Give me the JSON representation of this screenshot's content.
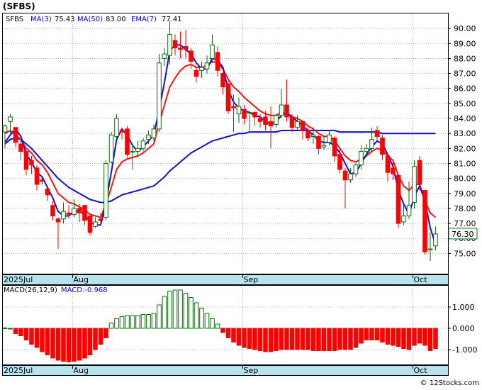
{
  "title": "(SFBS)",
  "legend": {
    "ticker": "SFBS",
    "ma3_label": "MA(3)",
    "ma3_value": "75.43",
    "ma50_label": "MA(50)",
    "ma50_value": "83.00",
    "ema7_label": "EMA(7)",
    "ema7_value": "77.41"
  },
  "macd_legend": {
    "label": "MACD(26,12,9)",
    "value_text": "MACD:-0.968"
  },
  "last_price": "76.30",
  "watermark": "© 12Stocks.com",
  "colors": {
    "up": "#0a6b0a",
    "down": "#ff0000",
    "ma_blue": "#1010d0",
    "ema_red": "#ff1010",
    "axis_strip": "#b7e3ef",
    "legend_blue": "#0000ff"
  },
  "chart_data": {
    "type": "candlestick",
    "price_axis": {
      "ylim": [
        73.6,
        91.0
      ],
      "ticks": [
        75.0,
        76.0,
        77.0,
        78.0,
        79.0,
        80.0,
        81.0,
        82.0,
        83.0,
        84.0,
        85.0,
        86.0,
        87.0,
        88.0,
        89.0,
        90.0
      ]
    },
    "price_tick_labels": [
      "75.00",
      "76.00",
      "77.00",
      "78.00",
      "79.00",
      "80.00",
      "81.00",
      "82.00",
      "83.00",
      "84.00",
      "85.00",
      "86.00",
      "87.00",
      "88.00",
      "89.00",
      "90.00"
    ],
    "x_labels": [
      {
        "text": "2025Jul",
        "index": 0
      },
      {
        "text": "Aug",
        "index": 13
      },
      {
        "text": "Sep",
        "index": 45
      },
      {
        "text": "Oct",
        "index": 77
      }
    ],
    "candles": [
      [
        83.1,
        83.6,
        83.5,
        82.0
      ],
      [
        83.8,
        84.3,
        84.1,
        83.0
      ],
      [
        83.4,
        83.4,
        82.4,
        82.1
      ],
      [
        82.3,
        82.6,
        81.8,
        81.2
      ],
      [
        81.8,
        81.9,
        80.6,
        80.2
      ],
      [
        81.2,
        81.5,
        80.9,
        80.3
      ],
      [
        80.7,
        80.9,
        79.6,
        79.2
      ],
      [
        79.9,
        80.1,
        79.8,
        79.6
      ],
      [
        79.3,
        79.3,
        78.9,
        78.5
      ],
      [
        78.2,
        78.5,
        77.5,
        77.2
      ],
      [
        77.3,
        77.4,
        77.1,
        75.3
      ],
      [
        77.3,
        78.4,
        77.8,
        77.0
      ],
      [
        77.7,
        78.2,
        77.6,
        77.3
      ],
      [
        77.6,
        78.6,
        78.0,
        77.4
      ],
      [
        78.0,
        78.3,
        77.7,
        77.1
      ],
      [
        78.2,
        78.2,
        77.2,
        76.9
      ],
      [
        77.5,
        77.5,
        76.4,
        76.2
      ],
      [
        76.8,
        77.4,
        77.1,
        76.7
      ],
      [
        77.3,
        77.7,
        77.2,
        76.9
      ],
      [
        77.4,
        81.2,
        81.0,
        77.2
      ],
      [
        81.1,
        83.1,
        82.9,
        81.0
      ],
      [
        82.8,
        84.3,
        84.0,
        82.6
      ],
      [
        83.2,
        83.4,
        83.1,
        82.6
      ],
      [
        83.3,
        83.5,
        81.6,
        81.4
      ],
      [
        81.8,
        82.3,
        81.8,
        80.6
      ],
      [
        81.8,
        82.5,
        82.0,
        81.4
      ],
      [
        82.0,
        82.7,
        82.5,
        81.8
      ],
      [
        82.6,
        83.2,
        82.9,
        82.3
      ],
      [
        82.7,
        83.6,
        83.3,
        82.5
      ],
      [
        83.3,
        88.3,
        87.7,
        83.1
      ],
      [
        88.0,
        88.7,
        88.3,
        87.5
      ],
      [
        88.2,
        90.5,
        89.6,
        87.6
      ],
      [
        89.2,
        89.6,
        88.7,
        88.2
      ],
      [
        88.7,
        89.8,
        88.6,
        88.0
      ],
      [
        88.8,
        89.9,
        88.6,
        88.0
      ],
      [
        88.5,
        88.7,
        87.8,
        87.3
      ],
      [
        87.2,
        87.5,
        86.8,
        86.4
      ],
      [
        87.2,
        87.8,
        87.4,
        86.7
      ],
      [
        87.3,
        88.2,
        87.7,
        87.0
      ],
      [
        88.0,
        89.6,
        88.9,
        87.7
      ],
      [
        88.4,
        88.8,
        87.2,
        86.8
      ],
      [
        87.0,
        87.1,
        86.1,
        85.6
      ],
      [
        86.3,
        86.5,
        84.5,
        84.3
      ],
      [
        84.8,
        85.6,
        84.7,
        83.1
      ],
      [
        84.3,
        85.4,
        84.8,
        83.7
      ],
      [
        84.6,
        84.9,
        84.0,
        83.6
      ],
      [
        84.4,
        84.5,
        84.4,
        83.2
      ],
      [
        84.4,
        84.5,
        84.1,
        83.5
      ],
      [
        84.0,
        84.3,
        83.8,
        83.4
      ],
      [
        84.1,
        84.5,
        83.6,
        83.2
      ],
      [
        83.8,
        84.8,
        83.5,
        82.0
      ],
      [
        83.6,
        84.3,
        84.2,
        83.4
      ],
      [
        84.2,
        86.0,
        84.9,
        84.0
      ],
      [
        84.9,
        86.6,
        84.1,
        83.8
      ],
      [
        84.1,
        84.3,
        83.4,
        83.1
      ],
      [
        83.4,
        84.2,
        83.8,
        83.2
      ],
      [
        83.8,
        83.8,
        83.2,
        82.6
      ],
      [
        83.2,
        83.4,
        82.7,
        82.5
      ],
      [
        82.8,
        83.4,
        82.9,
        82.3
      ],
      [
        82.8,
        82.9,
        82.0,
        81.6
      ],
      [
        82.1,
        82.8,
        82.2,
        81.9
      ],
      [
        82.4,
        83.2,
        82.9,
        82.2
      ],
      [
        82.7,
        82.8,
        81.5,
        81.1
      ],
      [
        81.6,
        82.0,
        80.6,
        80.3
      ],
      [
        80.5,
        80.7,
        79.9,
        78.0
      ],
      [
        79.9,
        80.7,
        80.3,
        79.7
      ],
      [
        80.3,
        81.0,
        80.9,
        80.1
      ],
      [
        80.9,
        82.2,
        81.8,
        80.6
      ],
      [
        81.8,
        82.3,
        82.0,
        81.4
      ],
      [
        82.0,
        83.4,
        82.6,
        81.8
      ],
      [
        83.2,
        83.5,
        82.8,
        82.5
      ],
      [
        82.7,
        82.9,
        81.6,
        81.2
      ],
      [
        81.5,
        81.7,
        80.4,
        79.8
      ],
      [
        80.7,
        81.1,
        80.3,
        79.9
      ],
      [
        80.2,
        80.3,
        77.0,
        76.7
      ],
      [
        77.1,
        78.3,
        77.5,
        76.9
      ],
      [
        77.5,
        79.8,
        78.2,
        77.3
      ],
      [
        78.4,
        81.2,
        80.8,
        78.0
      ],
      [
        81.2,
        81.5,
        79.6,
        79.2
      ],
      [
        79.2,
        79.2,
        75.1,
        74.9
      ],
      [
        75.3,
        76.4,
        75.3,
        74.5
      ],
      [
        75.5,
        76.8,
        76.3,
        75.2
      ]
    ],
    "ma3": [
      82.4,
      82.9,
      83.3,
      82.8,
      81.6,
      81.1,
      80.4,
      80.1,
      79.4,
      78.7,
      77.8,
      77.5,
      77.5,
      77.8,
      77.8,
      77.6,
      77.1,
      76.9,
      76.9,
      78.4,
      80.4,
      82.6,
      83.3,
      82.9,
      82.2,
      81.8,
      82.1,
      82.5,
      82.9,
      84.6,
      86.4,
      88.5,
      88.9,
      88.9,
      88.6,
      88.3,
      87.7,
      87.3,
      87.3,
      88.0,
      87.9,
      87.4,
      85.9,
      85.1,
      84.7,
      84.5,
      84.4,
      84.2,
      84.1,
      83.8,
      83.6,
      83.8,
      84.2,
      84.4,
      84.1,
      83.8,
      83.5,
      83.2,
      82.9,
      82.5,
      82.4,
      82.4,
      82.2,
      81.7,
      81.0,
      80.3,
      80.4,
      81.0,
      81.6,
      82.1,
      82.5,
      82.3,
      81.6,
      80.8,
      79.2,
      78.3,
      77.6,
      78.8,
      79.5,
      78.5,
      76.7,
      75.6
    ],
    "ma50": [
      82.3,
      82.6,
      82.7,
      82.6,
      82.3,
      82.0,
      81.6,
      81.2,
      80.8,
      80.4,
      80.0,
      79.7,
      79.4,
      79.2,
      79.0,
      78.8,
      78.6,
      78.5,
      78.4,
      78.4,
      78.5,
      78.7,
      78.9,
      79.0,
      79.1,
      79.2,
      79.3,
      79.4,
      79.5,
      79.8,
      80.1,
      80.5,
      80.8,
      81.1,
      81.4,
      81.7,
      81.9,
      82.1,
      82.3,
      82.5,
      82.6,
      82.7,
      82.8,
      82.9,
      83.0,
      83.0,
      83.1,
      83.1,
      83.1,
      83.1,
      83.1,
      83.1,
      83.2,
      83.2,
      83.2,
      83.2,
      83.2,
      83.2,
      83.2,
      83.2,
      83.2,
      83.2,
      83.2,
      83.1,
      83.1,
      83.1,
      83.1,
      83.1,
      83.1,
      83.1,
      83.1,
      83.0,
      83.0,
      83.0,
      83.0,
      83.0,
      83.0,
      83.0,
      83.0,
      83.0,
      83.0,
      83.0
    ],
    "ema7": [
      83.0,
      83.2,
      82.9,
      82.6,
      82.0,
      81.7,
      81.2,
      80.9,
      80.4,
      79.7,
      79.0,
      78.7,
      78.4,
      78.3,
      78.1,
      77.9,
      77.6,
      77.5,
      77.4,
      78.3,
      79.4,
      80.6,
      81.1,
      81.3,
      81.4,
      81.5,
      81.7,
      82.0,
      82.3,
      83.7,
      84.9,
      86.1,
      86.7,
      87.2,
      87.5,
      87.6,
      87.4,
      87.4,
      87.5,
      87.8,
      87.7,
      87.3,
      86.6,
      86.1,
      85.8,
      85.4,
      85.1,
      84.8,
      84.5,
      84.3,
      84.2,
      84.2,
      84.4,
      84.3,
      84.1,
      84.0,
      83.8,
      83.5,
      83.3,
      83.0,
      82.8,
      82.8,
      82.5,
      82.0,
      81.5,
      81.2,
      81.1,
      81.3,
      81.5,
      81.8,
      82.0,
      81.9,
      81.5,
      81.2,
      80.2,
      79.5,
      79.2,
      79.6,
      79.6,
      78.5,
      77.7,
      77.4
    ],
    "macd_axis": {
      "ylim": [
        -1.7,
        2.0
      ],
      "ticks": [
        1.0,
        0.0,
        -1.0
      ]
    },
    "macd_tick_labels": [
      "1.000",
      "0.000",
      "-1.000"
    ],
    "macd_hist": [
      0.02,
      0.0,
      -0.25,
      -0.35,
      -0.55,
      -0.75,
      -0.9,
      -1.1,
      -1.25,
      -1.4,
      -1.5,
      -1.55,
      -1.58,
      -1.55,
      -1.5,
      -1.4,
      -1.25,
      -1.0,
      -0.75,
      -0.45,
      0.25,
      0.45,
      0.55,
      0.6,
      0.6,
      0.6,
      0.65,
      0.65,
      0.7,
      1.1,
      1.5,
      1.75,
      1.8,
      1.8,
      1.65,
      1.45,
      1.2,
      0.95,
      0.7,
      0.45,
      0.2,
      -0.2,
      -0.45,
      -0.65,
      -0.8,
      -0.9,
      -0.95,
      -1.0,
      -1.05,
      -1.1,
      -1.1,
      -1.05,
      -1.0,
      -1.0,
      -1.0,
      -1.0,
      -1.0,
      -1.0,
      -1.05,
      -1.05,
      -1.05,
      -1.05,
      -1.05,
      -1.0,
      -1.0,
      -1.0,
      -0.9,
      -0.7,
      -0.55,
      -0.55,
      -0.55,
      -0.65,
      -0.75,
      -0.8,
      -0.85,
      -0.95,
      -1.0,
      -0.8,
      -0.7,
      -0.8,
      -1.05,
      -0.95
    ],
    "macd_hist_colors": [
      "up",
      "up",
      "down",
      "down",
      "down",
      "down",
      "down",
      "down",
      "down",
      "down",
      "down",
      "down",
      "down",
      "down",
      "down",
      "down",
      "down",
      "down",
      "down",
      "down",
      "up",
      "up",
      "up",
      "up",
      "up",
      "up",
      "up",
      "up",
      "up",
      "up",
      "up",
      "up",
      "up",
      "up",
      "up",
      "up",
      "up",
      "up",
      "up",
      "up",
      "up",
      "down",
      "down",
      "down",
      "down",
      "down",
      "down",
      "down",
      "down",
      "down",
      "down",
      "down",
      "down",
      "down",
      "down",
      "down",
      "down",
      "down",
      "down",
      "down",
      "down",
      "down",
      "down",
      "down",
      "down",
      "down",
      "down",
      "down",
      "down",
      "down",
      "down",
      "down",
      "down",
      "down",
      "down",
      "down",
      "down",
      "down",
      "down",
      "down",
      "down",
      "down"
    ]
  }
}
